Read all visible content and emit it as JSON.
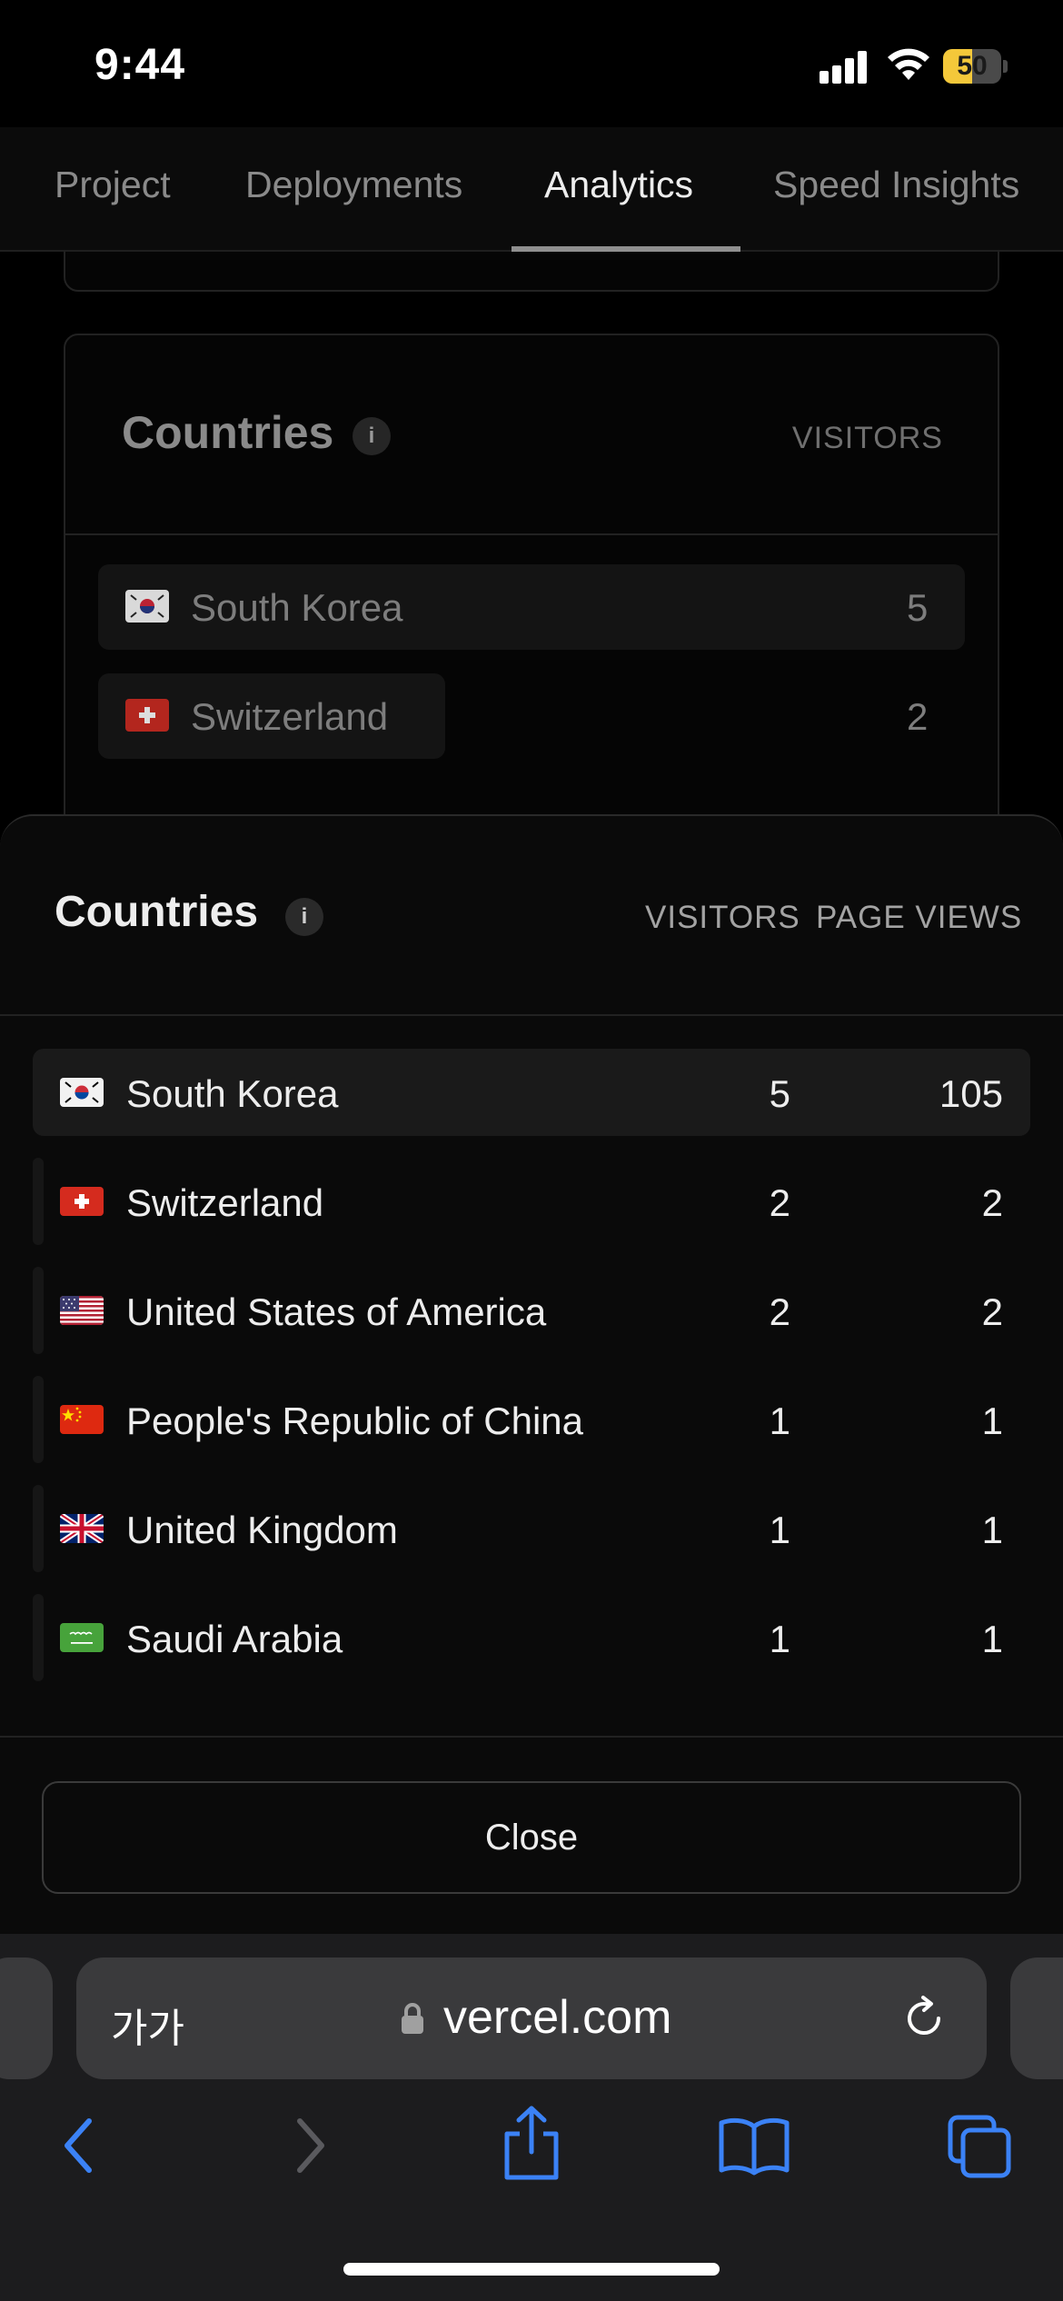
{
  "status_bar": {
    "time": "9:44",
    "battery_level": "50",
    "battery_fraction": 0.5,
    "battery_color": "#f4c83a"
  },
  "tabs": [
    {
      "label": "Project",
      "active": false
    },
    {
      "label": "Deployments",
      "active": false
    },
    {
      "label": "Analytics",
      "active": true
    },
    {
      "label": "Speed Insights",
      "active": false
    }
  ],
  "background_card": {
    "title": "Countries",
    "info_label": "i",
    "column_label": "VISITORS",
    "rows": [
      {
        "country": "South Korea",
        "visitors": "5"
      },
      {
        "country": "Switzerland",
        "visitors": "2"
      }
    ]
  },
  "sheet": {
    "title": "Countries",
    "info_label": "i",
    "columns": {
      "visitors": "VISITORS",
      "page_views": "PAGE VIEWS"
    },
    "rows": [
      {
        "country": "South Korea",
        "flag": "south-korea-flag-icon",
        "visitors": "5",
        "page_views": "105",
        "visitor_share": 1.0
      },
      {
        "country": "Switzerland",
        "flag": "switzerland-flag-icon",
        "visitors": "2",
        "page_views": "2",
        "visitor_share": 0.4
      },
      {
        "country": "United States of America",
        "flag": "usa-flag-icon",
        "visitors": "2",
        "page_views": "2",
        "visitor_share": 0.4
      },
      {
        "country": "People's Republic of China",
        "flag": "china-flag-icon",
        "visitors": "1",
        "page_views": "1",
        "visitor_share": 0.2
      },
      {
        "country": "United Kingdom",
        "flag": "uk-flag-icon",
        "visitors": "1",
        "page_views": "1",
        "visitor_share": 0.2
      },
      {
        "country": "Saudi Arabia",
        "flag": "saudi-arabia-flag-icon",
        "visitors": "1",
        "page_views": "1",
        "visitor_share": 0.2
      }
    ],
    "close_label": "Close"
  },
  "browser": {
    "reader_label": "가가",
    "url": "vercel.com",
    "accent_color": "#3b82f6"
  }
}
